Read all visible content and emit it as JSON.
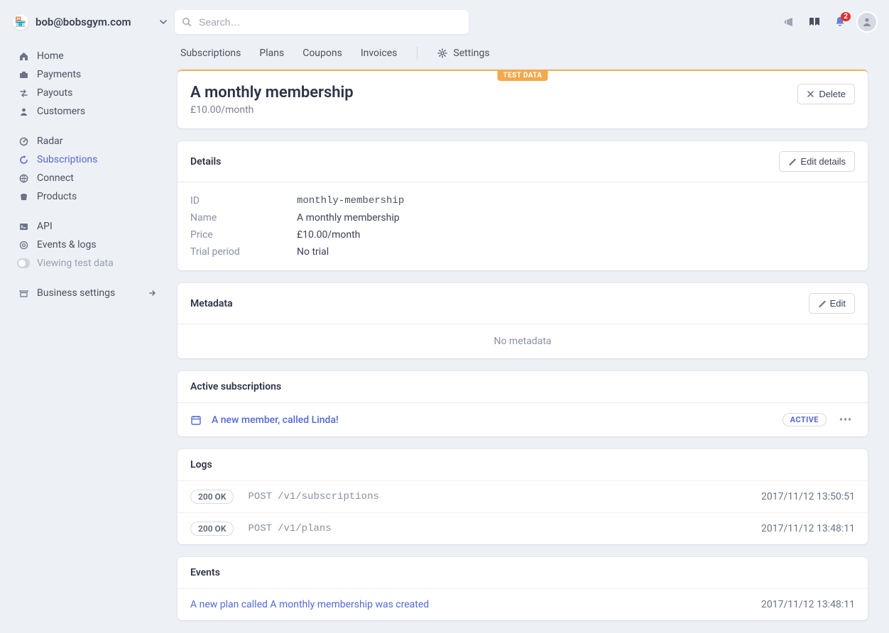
{
  "account": {
    "email": "bob@bobsgym.com",
    "avatar_emoji": "🏪"
  },
  "search": {
    "placeholder": "Search…"
  },
  "header_icons": {
    "notif_count": "2"
  },
  "sidebar": {
    "group1": [
      {
        "label": "Home"
      },
      {
        "label": "Payments"
      },
      {
        "label": "Payouts"
      },
      {
        "label": "Customers"
      }
    ],
    "group2": [
      {
        "label": "Radar"
      },
      {
        "label": "Subscriptions"
      },
      {
        "label": "Connect"
      },
      {
        "label": "Products"
      }
    ],
    "group3": [
      {
        "label": "API"
      },
      {
        "label": "Events & logs"
      },
      {
        "label": "Viewing test data"
      }
    ],
    "settings_label": "Business settings"
  },
  "tabs": {
    "items": [
      "Subscriptions",
      "Plans",
      "Coupons",
      "Invoices"
    ],
    "settings": "Settings"
  },
  "hero": {
    "test_badge": "TEST DATA",
    "title": "A monthly membership",
    "price": "£10.00/month",
    "delete": "Delete"
  },
  "details": {
    "title": "Details",
    "edit": "Edit details",
    "rows": {
      "id_label": "ID",
      "id_value": "monthly-membership",
      "name_label": "Name",
      "name_value": "A monthly membership",
      "price_label": "Price",
      "price_value": "£10.00/month",
      "trial_label": "Trial period",
      "trial_value": "No trial"
    }
  },
  "metadata": {
    "title": "Metadata",
    "edit": "Edit",
    "empty": "No metadata"
  },
  "active_subs": {
    "title": "Active subscriptions",
    "row_text": "A new member, called Linda!",
    "status": "ACTIVE"
  },
  "logs": {
    "title": "Logs",
    "rows": [
      {
        "status": "200 OK",
        "method": "POST",
        "path": "/v1/subscriptions",
        "time": "2017/11/12 13:50:51"
      },
      {
        "status": "200 OK",
        "method": "POST",
        "path": "/v1/plans",
        "time": "2017/11/12 13:48:11"
      }
    ]
  },
  "events": {
    "title": "Events",
    "rows": [
      {
        "text": "A new plan called A monthly membership was created",
        "time": "2017/11/12 13:48:11"
      }
    ]
  }
}
